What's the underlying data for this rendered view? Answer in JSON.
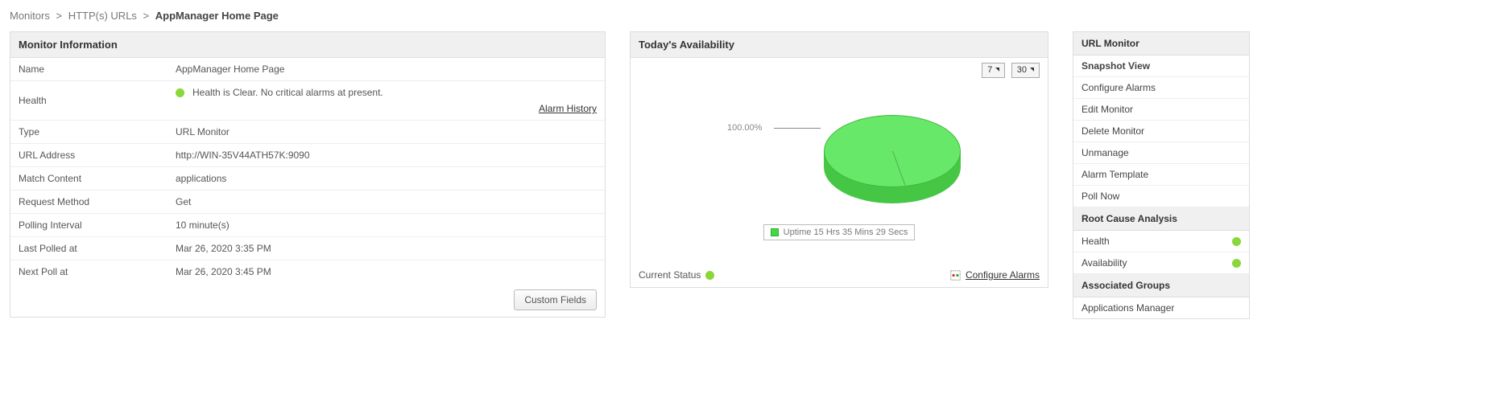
{
  "breadcrumb": {
    "items": [
      "Monitors",
      "HTTP(s) URLs"
    ],
    "current": "AppManager Home Page"
  },
  "monitor_info": {
    "header": "Monitor Information",
    "name_label": "Name",
    "name_value": "AppManager Home Page",
    "health_label": "Health",
    "health_value": "Health is Clear. No critical alarms at present.",
    "alarm_history": "Alarm History",
    "type_label": "Type",
    "type_value": "URL Monitor",
    "url_label": "URL Address",
    "url_value": "http://WIN-35V44ATH57K:9090",
    "match_label": "Match Content",
    "match_value": "applications",
    "request_label": "Request Method",
    "request_value": "Get",
    "polling_label": "Polling Interval",
    "polling_value": "10 minute(s)",
    "last_polled_label": "Last Polled at",
    "last_polled_value": "Mar 26, 2020 3:35 PM",
    "next_poll_label": "Next Poll at",
    "next_poll_value": "Mar 26, 2020 3:45 PM",
    "custom_fields_btn": "Custom Fields"
  },
  "availability": {
    "header": "Today's Availability",
    "toggle7": "7",
    "toggle30": "30",
    "percent_label": "100.00%",
    "legend": "Uptime 15 Hrs 35 Mins 29 Secs",
    "current_status_label": "Current Status",
    "configure_alarms": "Configure Alarms"
  },
  "sidebar": {
    "title": "URL Monitor",
    "items": [
      {
        "label": "Snapshot View",
        "active": true
      },
      {
        "label": "Configure Alarms"
      },
      {
        "label": "Edit Monitor"
      },
      {
        "label": "Delete Monitor"
      },
      {
        "label": "Unmanage"
      },
      {
        "label": "Alarm Template"
      },
      {
        "label": "Poll Now"
      }
    ],
    "rca_header": "Root Cause Analysis",
    "rca_items": [
      {
        "label": "Health"
      },
      {
        "label": "Availability"
      }
    ],
    "groups_header": "Associated Groups",
    "groups_items": [
      {
        "label": "Applications Manager"
      }
    ]
  },
  "chart_data": {
    "type": "pie",
    "title": "Today's Availability",
    "categories": [
      "Uptime"
    ],
    "values": [
      100.0
    ],
    "legend": [
      "Uptime 15 Hrs 35 Mins 29 Secs"
    ],
    "ylim": [
      0,
      100
    ]
  }
}
